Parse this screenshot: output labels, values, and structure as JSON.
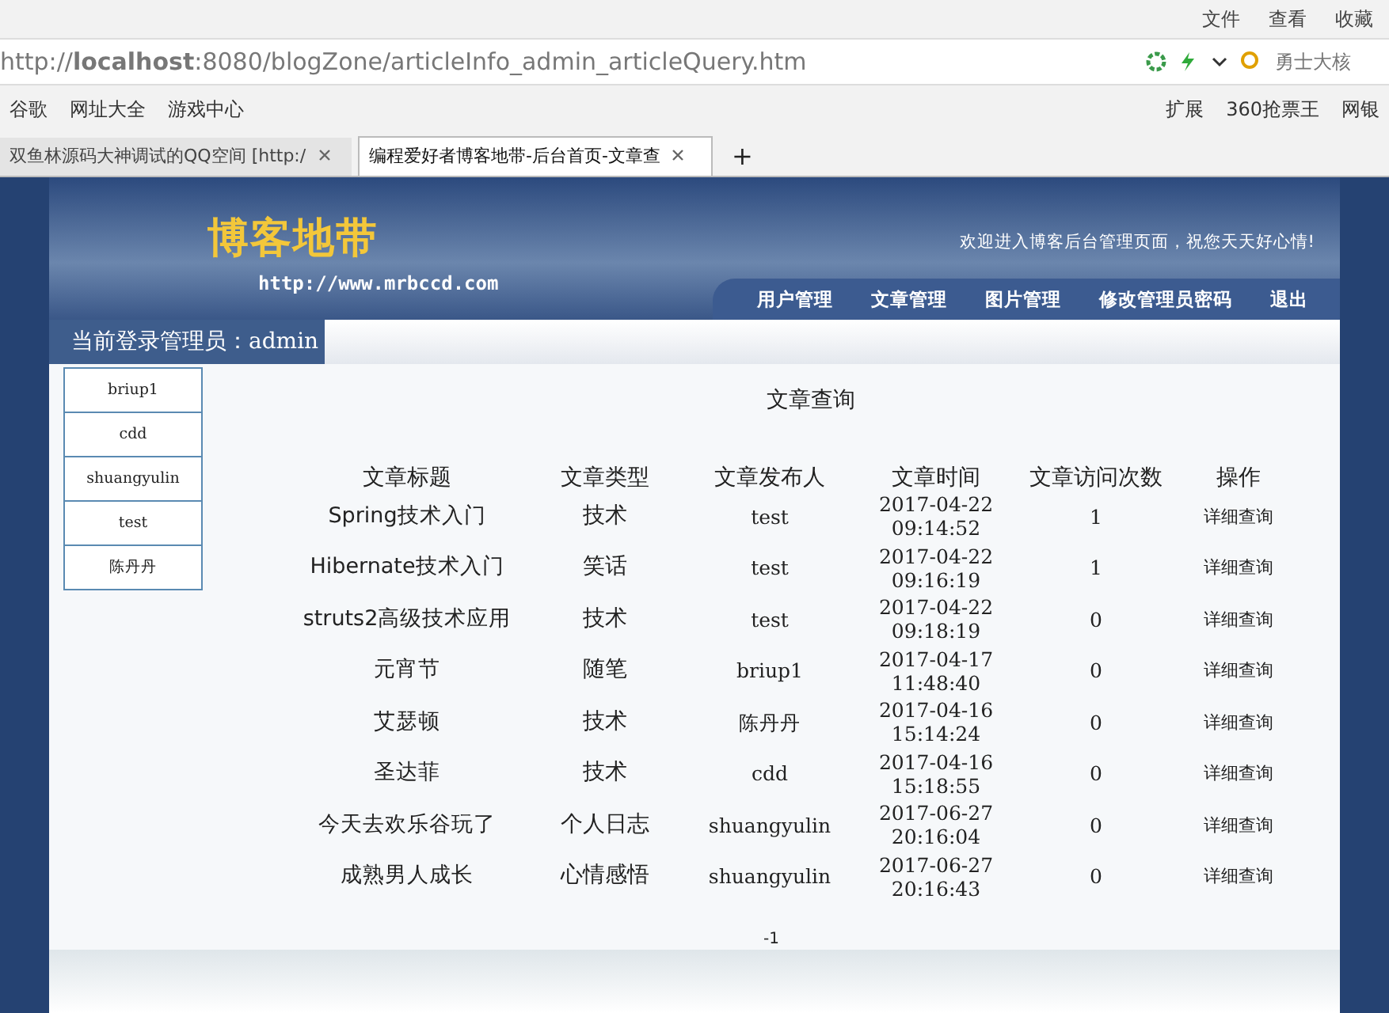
{
  "browser": {
    "menu": [
      "文件",
      "查看",
      "收藏"
    ],
    "address": "http://**localhost**:8080/blogZone/articleInfo_admin_articleQuery.htm",
    "search_placeholder": "勇士大核",
    "bookmarks_left": [
      "谷歌",
      "网址大全",
      "游戏中心"
    ],
    "bookmarks_right": [
      "扩展",
      "360抢票王",
      "网银"
    ],
    "tabs": [
      {
        "label": "双鱼林源码大神调试的QQ空间 [http:/",
        "selected": false
      },
      {
        "label": "编程爱好者博客地带-后台首页-文章查",
        "selected": true
      }
    ],
    "new_tab": "+"
  },
  "header": {
    "logo": "博客地带",
    "url": "http://www.mrbccd.com",
    "welcome": "欢迎进入博客后台管理页面，祝您天天好心情!",
    "nav": [
      "用户管理",
      "文章管理",
      "图片管理",
      "修改管理员密码",
      "退出"
    ]
  },
  "admin_bar": "当前登录管理员：admin",
  "sidebar": {
    "items": [
      "briup1",
      "cdd",
      "shuangyulin",
      "test",
      "陈丹丹"
    ]
  },
  "table": {
    "title": "文章查询",
    "columns": [
      "文章标题",
      "文章类型",
      "文章发布人",
      "文章时间",
      "文章访问次数",
      "操作"
    ],
    "rows": [
      {
        "title": "Spring技术入门",
        "type": "技术",
        "author": "test",
        "date": "2017-04-22",
        "time": "09:14:52",
        "visits": "1",
        "action": "详细查询"
      },
      {
        "title": "Hibernate技术入门",
        "type": "笑话",
        "author": "test",
        "date": "2017-04-22",
        "time": "09:16:19",
        "visits": "1",
        "action": "详细查询"
      },
      {
        "title": "struts2高级技术应用",
        "type": "技术",
        "author": "test",
        "date": "2017-04-22",
        "time": "09:18:19",
        "visits": "0",
        "action": "详细查询"
      },
      {
        "title": "元宵节",
        "type": "随笔",
        "author": "briup1",
        "date": "2017-04-17",
        "time": "11:48:40",
        "visits": "0",
        "action": "详细查询"
      },
      {
        "title": "艾瑟顿",
        "type": "技术",
        "author": "陈丹丹",
        "date": "2017-04-16",
        "time": "15:14:24",
        "visits": "0",
        "action": "详细查询"
      },
      {
        "title": "圣达菲",
        "type": "技术",
        "author": "cdd",
        "date": "2017-04-16",
        "time": "15:18:55",
        "visits": "0",
        "action": "详细查询"
      },
      {
        "title": "今天去欢乐谷玩了",
        "type": "个人日志",
        "author": "shuangyulin",
        "date": "2017-06-27",
        "time": "20:16:04",
        "visits": "0",
        "action": "详细查询"
      },
      {
        "title": "成熟男人成长",
        "type": "心情感悟",
        "author": "shuangyulin",
        "date": "2017-06-27",
        "time": "20:16:43",
        "visits": "0",
        "action": "详细查询"
      }
    ]
  },
  "pagination": "-1"
}
